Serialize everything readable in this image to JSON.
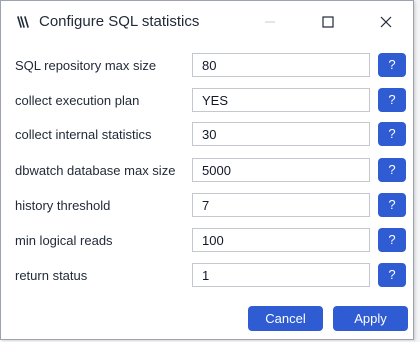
{
  "window": {
    "title": "Configure SQL statistics",
    "logo_icon": "dbwatch-logo-icon",
    "minimize_icon": "minimize-icon",
    "maximize_icon": "maximize-icon",
    "close_icon": "close-icon"
  },
  "settings": [
    {
      "label": "SQL repository max size",
      "value": "80",
      "help": "?"
    },
    {
      "label": "collect execution plan",
      "value": "YES",
      "help": "?"
    },
    {
      "label": "collect internal statistics",
      "value": "30",
      "help": "?"
    },
    {
      "label": "dbwatch database max size",
      "value": "5000",
      "help": "?"
    },
    {
      "label": "history threshold",
      "value": "7",
      "help": "?"
    },
    {
      "label": "min logical reads",
      "value": "100",
      "help": "?"
    },
    {
      "label": "return status",
      "value": "1",
      "help": "?"
    }
  ],
  "footer": {
    "cancel_label": "Cancel",
    "apply_label": "Apply"
  },
  "colors": {
    "accent": "#2f5bd3",
    "text": "#1f2937",
    "input_border": "#c4c8ce"
  }
}
